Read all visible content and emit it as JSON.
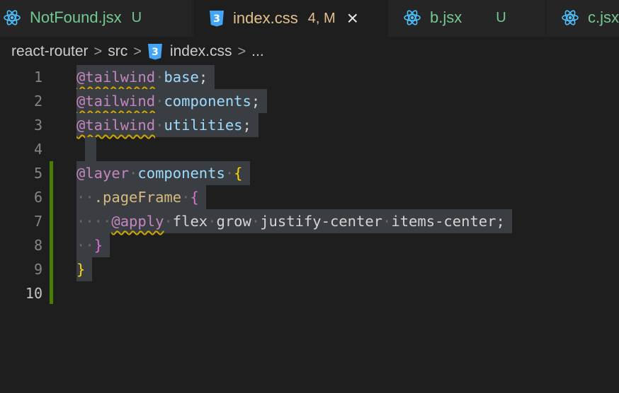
{
  "tabs": [
    {
      "name": "NotFound.jsx",
      "status": "U",
      "icon": "react-icon"
    },
    {
      "name": "index.css",
      "status": "4, M",
      "icon": "css-icon",
      "active": true,
      "close": "×"
    },
    {
      "name": "b.jsx",
      "status": "U",
      "icon": "react-icon"
    },
    {
      "name": "c.jsx",
      "status": "",
      "icon": "react-icon"
    }
  ],
  "breadcrumb": {
    "folder": "react-router",
    "sub": "src",
    "file": "index.css",
    "more": "..."
  },
  "editor": {
    "line_numbers": [
      "1",
      "2",
      "3",
      "4",
      "5",
      "6",
      "7",
      "8",
      "9",
      "10"
    ],
    "lines": {
      "l1": {
        "kw": "@tailwind",
        "arg": "base",
        "end": ";"
      },
      "l2": {
        "kw": "@tailwind",
        "arg": "components",
        "end": ";"
      },
      "l3": {
        "kw": "@tailwind",
        "arg": "utilities",
        "end": ";"
      },
      "l5": {
        "kw": "@layer",
        "arg": "components",
        "brace": "{"
      },
      "l6": {
        "selector": ".pageFrame",
        "brace": "{"
      },
      "l7": {
        "kw": "@apply",
        "utils": [
          "flex",
          "grow",
          "justify-center",
          "items-center"
        ],
        "end": ";"
      },
      "l8": {
        "brace": "}"
      },
      "l9": {
        "brace": "}"
      }
    }
  },
  "colors": {
    "background": "#1e1e1e",
    "tab_bar": "#252526",
    "untracked_green": "#73c991",
    "modified_yellow": "#e2c08d",
    "gutter_modified": "#487e02",
    "selection": "#3a3d41",
    "keyword": "#c586c0",
    "identifier": "#9cdcfe"
  }
}
